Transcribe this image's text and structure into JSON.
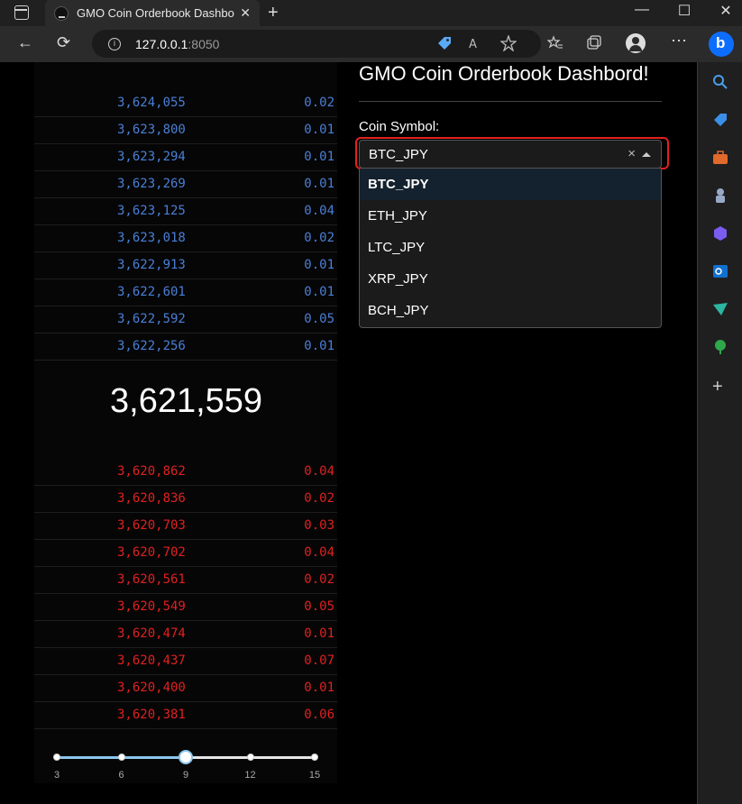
{
  "browser": {
    "tab_title": "GMO Coin Orderbook Dashbord!",
    "url_host": "127.0.0.1",
    "url_port": ":8050",
    "new_tab_label": "+",
    "close_label": "✕",
    "minimize_label": "—",
    "maximize_label": "☐",
    "window_close_label": "✕"
  },
  "page": {
    "title": "GMO Coin Orderbook Dashbord!",
    "coin_label": "Coin Symbol:",
    "selected_symbol": "BTC_JPY",
    "clear_label": "×",
    "options": [
      "BTC_JPY",
      "ETH_JPY",
      "LTC_JPY",
      "XRP_JPY",
      "BCH_JPY"
    ]
  },
  "orderbook": {
    "asks": [
      {
        "price": "3,624,055",
        "size": "0.02"
      },
      {
        "price": "3,623,800",
        "size": "0.01"
      },
      {
        "price": "3,623,294",
        "size": "0.01"
      },
      {
        "price": "3,623,269",
        "size": "0.01"
      },
      {
        "price": "3,623,125",
        "size": "0.04"
      },
      {
        "price": "3,623,018",
        "size": "0.02"
      },
      {
        "price": "3,622,913",
        "size": "0.01"
      },
      {
        "price": "3,622,601",
        "size": "0.01"
      },
      {
        "price": "3,622,592",
        "size": "0.05"
      },
      {
        "price": "3,622,256",
        "size": "0.01"
      }
    ],
    "mid_price": "3,621,559",
    "bids": [
      {
        "price": "3,620,862",
        "size": "0.04"
      },
      {
        "price": "3,620,836",
        "size": "0.02"
      },
      {
        "price": "3,620,703",
        "size": "0.03"
      },
      {
        "price": "3,620,702",
        "size": "0.04"
      },
      {
        "price": "3,620,561",
        "size": "0.02"
      },
      {
        "price": "3,620,549",
        "size": "0.05"
      },
      {
        "price": "3,620,474",
        "size": "0.01"
      },
      {
        "price": "3,620,437",
        "size": "0.07"
      },
      {
        "price": "3,620,400",
        "size": "0.01"
      },
      {
        "price": "3,620,381",
        "size": "0.06"
      }
    ]
  },
  "slider": {
    "marks": [
      "3",
      "6",
      "9",
      "12",
      "15"
    ],
    "value": 9,
    "min": 3,
    "max": 15
  },
  "colors": {
    "ask": "#4a7fd6",
    "bid": "#e02020",
    "accent": "#8cc7ec",
    "focus": "#e32020"
  },
  "icons": {
    "back": "←",
    "refresh": "⟳",
    "info": "i",
    "more": "⋯",
    "add": "+"
  }
}
